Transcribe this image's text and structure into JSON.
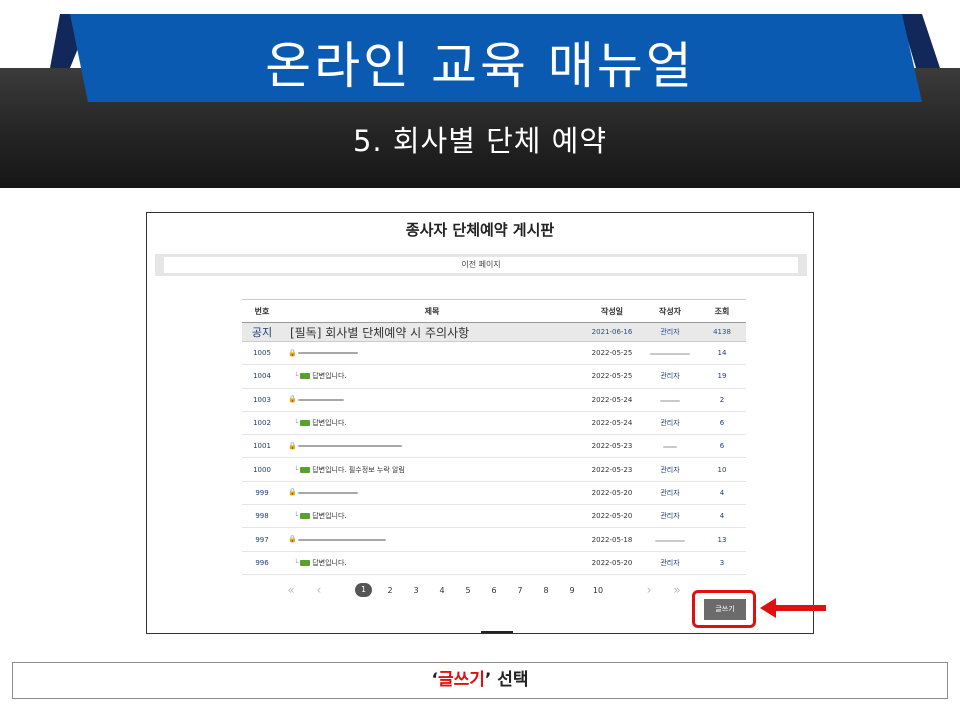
{
  "header": {
    "title": "온라인 교육 매뉴얼",
    "subtitle": "5. 회사별 단체 예약",
    "banner_color": "#0a5ab1",
    "band_color": "#242424"
  },
  "board": {
    "title": "종사자 단체예약 게시판",
    "prev_page_label": "이전 페이지",
    "columns": [
      "번호",
      "제목",
      "작성일",
      "작성자",
      "조회"
    ],
    "notice": {
      "no": "공지",
      "title": "[필독] 회사별 단체예약 시 주의사항",
      "date": "2021-06-16",
      "author": "관리자",
      "views": "4138"
    },
    "rows": [
      {
        "no": "1005",
        "title": "",
        "kind": "locked",
        "date": "2022-05-25",
        "author": "",
        "views": "14"
      },
      {
        "no": "1004",
        "title": "답변입니다.",
        "kind": "reply",
        "date": "2022-05-25",
        "author": "관리자",
        "views": "19"
      },
      {
        "no": "1003",
        "title": "",
        "kind": "locked",
        "date": "2022-05-24",
        "author": "",
        "views": "2"
      },
      {
        "no": "1002",
        "title": "답변입니다.",
        "kind": "reply",
        "date": "2022-05-24",
        "author": "관리자",
        "views": "6"
      },
      {
        "no": "1001",
        "title": "",
        "kind": "locked",
        "date": "2022-05-23",
        "author": "",
        "views": "6"
      },
      {
        "no": "1000",
        "title": "답변입니다. 필수정보 누락 알림",
        "kind": "reply",
        "date": "2022-05-23",
        "author": "관리자",
        "views": "10"
      },
      {
        "no": "999",
        "title": "",
        "kind": "locked",
        "date": "2022-05-20",
        "author": "관리자",
        "views": "4"
      },
      {
        "no": "998",
        "title": "답변입니다.",
        "kind": "reply",
        "date": "2022-05-20",
        "author": "관리자",
        "views": "4"
      },
      {
        "no": "997",
        "title": "",
        "kind": "locked",
        "date": "2022-05-18",
        "author": "",
        "views": "13"
      },
      {
        "no": "996",
        "title": "답변입니다.",
        "kind": "reply",
        "date": "2022-05-20",
        "author": "관리자",
        "views": "3"
      }
    ],
    "pagination": {
      "first": "«",
      "prev": "‹",
      "pages": [
        "1",
        "2",
        "3",
        "4",
        "5",
        "6",
        "7",
        "8",
        "9",
        "10"
      ],
      "current": "1",
      "next": "›",
      "last": "»"
    },
    "write_button": "글쓰기"
  },
  "caption": {
    "open_quote": "‘",
    "highlight": "글쓰기",
    "close_quote": "’",
    "rest": " 선택",
    "highlight_color": "#e01010"
  }
}
